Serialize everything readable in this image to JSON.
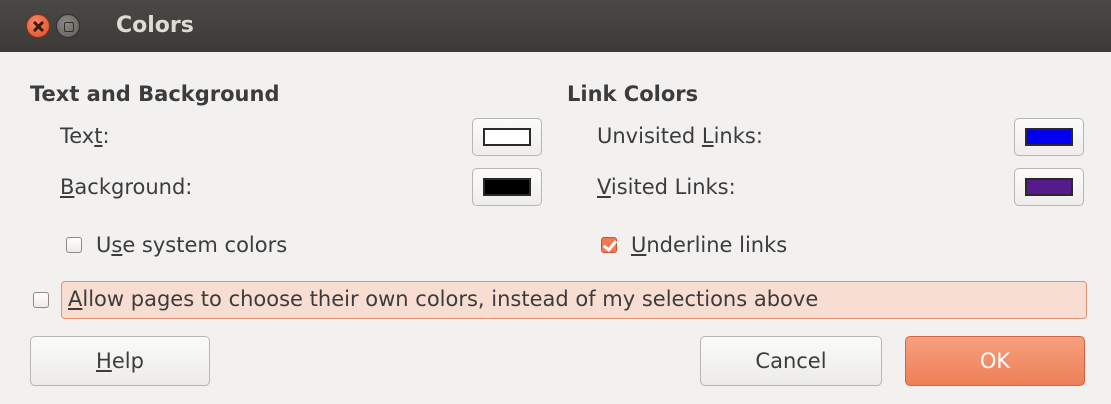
{
  "window": {
    "title": "Colors"
  },
  "text_and_background": {
    "heading": "Text and Background",
    "text_label": {
      "pre": "Tex",
      "mnemonic": "t",
      "post": ":"
    },
    "text_color": "#ffffff",
    "background_label": {
      "pre": "",
      "mnemonic": "B",
      "post": "ackground:"
    },
    "background_color": "#000000",
    "use_system_colors": {
      "pre": "U",
      "mnemonic": "s",
      "post": "e system colors",
      "checked": false
    }
  },
  "link_colors": {
    "heading": "Link Colors",
    "unvisited_label": {
      "pre": "Unvisited ",
      "mnemonic": "L",
      "post": "inks:"
    },
    "unvisited_color": "#0000ee",
    "visited_label": {
      "pre": "",
      "mnemonic": "V",
      "post": "isited Links:"
    },
    "visited_color": "#551a8b",
    "underline_links": {
      "pre": "",
      "mnemonic": "U",
      "post": "nderline links",
      "checked": true
    }
  },
  "allow_pages": {
    "pre": "",
    "mnemonic": "A",
    "post": "llow pages to choose their own colors, instead of my selections above",
    "checked": false
  },
  "buttons": {
    "help": {
      "pre": "",
      "mnemonic": "H",
      "post": "elp"
    },
    "cancel": "Cancel",
    "ok": "OK"
  },
  "theme": {
    "accent": "#ef7a54",
    "titlebar": "#3b3a36",
    "background": "#f2f1f0"
  }
}
